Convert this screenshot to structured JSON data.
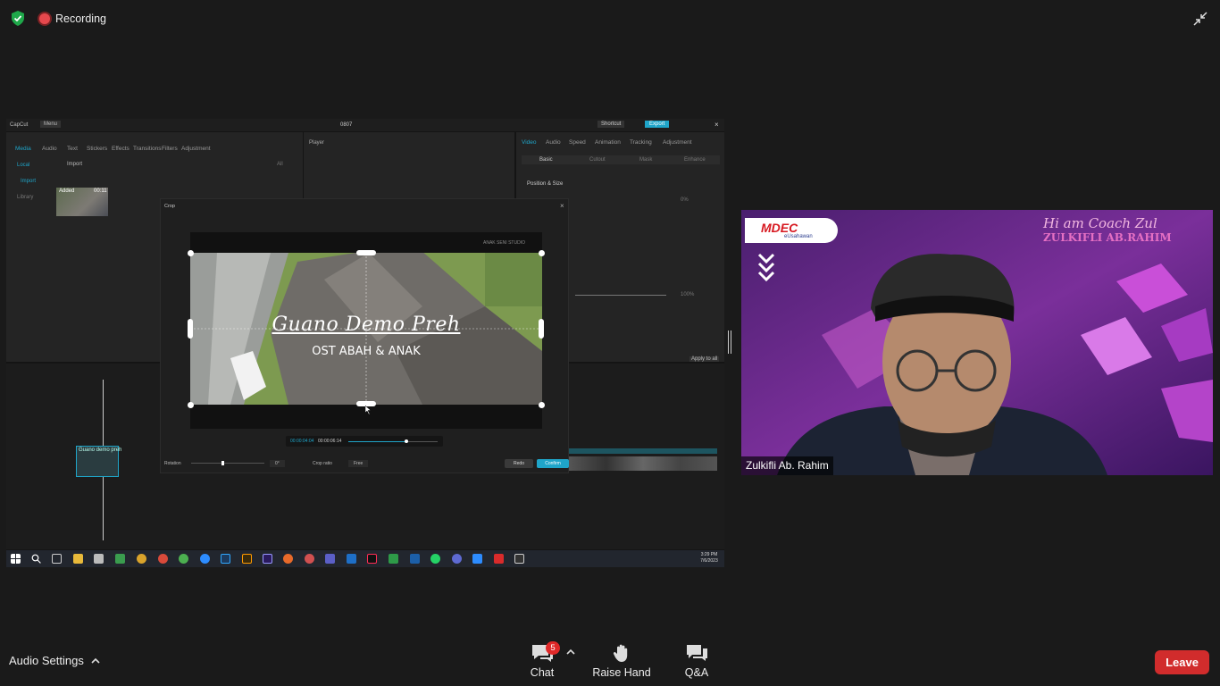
{
  "meeting": {
    "recording_label": "Recording"
  },
  "shared_screen": {
    "app": {
      "name": "CapCut",
      "menu_label": "Menu",
      "project_title": "0807",
      "shortcut_label": "Shortcut",
      "export_label": "Export",
      "toolbar": [
        "Media",
        "Audio",
        "Text",
        "Stickers",
        "Effects",
        "Transitions",
        "Filters",
        "Adjustment"
      ],
      "sidebar": [
        "Local",
        "Import",
        "Library"
      ],
      "import_label": "Import",
      "media_filter": "All",
      "clip_added_label": "Added",
      "clip_duration": "00:11",
      "player_label": "Player",
      "props_tabs": [
        "Video",
        "Audio",
        "Speed",
        "Animation",
        "Tracking",
        "Adjustment"
      ],
      "props_subtabs": [
        "Basic",
        "Cutout",
        "Mask",
        "Enhance"
      ],
      "position_size_label": "Position & Size",
      "scale_value": "0%",
      "opacity_value": "100%",
      "apply_all_label": "Apply to all",
      "timeline_clip_label": "Guano demo preh",
      "timeline_clip_label2": "Guano demo preh"
    },
    "crop_dialog": {
      "title": "Crop",
      "video_studio_text": "ANAK SENI STUDIO",
      "video_title": "Guano Demo Preh",
      "video_subtitle": "OST ABAH & ANAK",
      "time_current": "00:00:04:04",
      "time_total": "00:00:06:14",
      "playback_progress": 0.65,
      "rotation_label": "Rotation",
      "rotation_value": "0°",
      "crop_ratio_label": "Crop ratio",
      "crop_ratio_value": "Free",
      "redo_label": "Redo",
      "confirm_label": "Confirm"
    },
    "taskbar": {
      "time": "3:29 PM",
      "date": "7/6/2023"
    }
  },
  "video": {
    "logo_text": "MDEC",
    "logo_subtext": "eUsahawan",
    "overlay_line1": "Hi am Coach Zul",
    "overlay_line2": "ZULKIFLI AB.RAHIM",
    "participant_name": "Zulkifli Ab. Rahim"
  },
  "controls": {
    "audio_settings_label": "Audio Settings",
    "chat_label": "Chat",
    "chat_badge": "5",
    "raise_hand_label": "Raise Hand",
    "qa_label": "Q&A",
    "leave_label": "Leave"
  },
  "colors": {
    "accent_teal": "#1fa5c9",
    "leave_red": "#d12c2c",
    "badge_red": "#e02828",
    "shield_green": "#1fa84a"
  }
}
